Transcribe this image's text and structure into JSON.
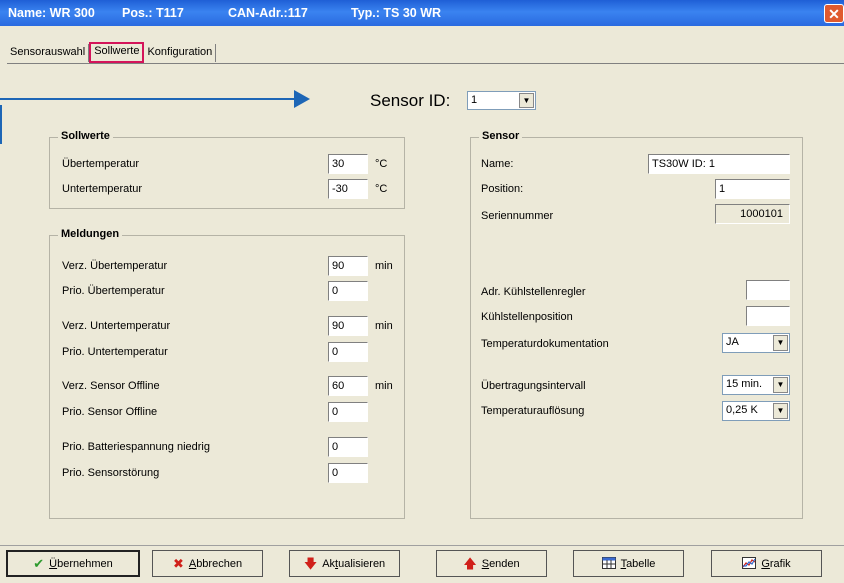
{
  "window": {
    "name_label": "Name: WR 300",
    "pos_label": "Pos.: T117",
    "can_label": "CAN-Adr.:117",
    "typ_label": "Typ.: TS 30 WR",
    "close_glyph": "✕"
  },
  "tabs": [
    {
      "label": "Sensorauswahl",
      "active": false
    },
    {
      "label": "Sollwerte",
      "active": true
    },
    {
      "label": "Konfiguration",
      "active": false
    }
  ],
  "sensor_id": {
    "label": "Sensor ID:",
    "value": "1"
  },
  "sollwerte": {
    "title": "Sollwerte",
    "rows": [
      {
        "label": "Übertemperatur",
        "value": "30",
        "unit": "°C"
      },
      {
        "label": "Untertemperatur",
        "value": "-30",
        "unit": "°C"
      }
    ]
  },
  "meldungen": {
    "title": "Meldungen",
    "rows": [
      {
        "label": "Verz. Übertemperatur",
        "value": "90",
        "unit": "min"
      },
      {
        "label": "Prio. Übertemperatur",
        "value": "0",
        "unit": ""
      },
      {
        "label": "Verz. Untertemperatur",
        "value": "90",
        "unit": "min"
      },
      {
        "label": "Prio. Untertemperatur",
        "value": "0",
        "unit": ""
      },
      {
        "label": "Verz. Sensor Offline",
        "value": "60",
        "unit": "min"
      },
      {
        "label": "Prio. Sensor Offline",
        "value": "0",
        "unit": ""
      },
      {
        "label": "Prio. Batteriespannung niedrig",
        "value": "0",
        "unit": ""
      },
      {
        "label": "Prio. Sensorstörung",
        "value": "0",
        "unit": ""
      }
    ]
  },
  "sensor": {
    "title": "Sensor",
    "name_label": "Name:",
    "name_value": "TS30W ID: 1",
    "position_label": "Position:",
    "position_value": "1",
    "serial_label": "Seriennummer",
    "serial_value": "1000101",
    "adr_label": "Adr. Kühlstellenregler",
    "adr_value": "",
    "kpos_label": "Kühlstellenposition",
    "kpos_value": "",
    "tempdoc_label": "Temperaturdokumentation",
    "tempdoc_value": "JA",
    "interval_label": "Übertragungsintervall",
    "interval_value": "15 min.",
    "resolution_label": "Temperaturauflösung",
    "resolution_value": "0,25 K"
  },
  "buttons": {
    "apply": {
      "first": "Ü",
      "rest": "bernehmen",
      "icon": "checkmark-icon",
      "color": "#2e9a2e"
    },
    "cancel": {
      "first": "A",
      "rest": "bbrechen",
      "icon": "x-icon",
      "color": "#d0201a"
    },
    "refresh": {
      "pre": "Ak",
      "ul": "t",
      "post": "ualisieren",
      "icon": "arrow-down-icon",
      "color": "#d0201a"
    },
    "send": {
      "first": "S",
      "rest": "enden",
      "icon": "arrow-up-icon",
      "color": "#d0201a"
    },
    "table": {
      "first": "T",
      "rest": "abelle",
      "icon": "table-icon"
    },
    "chart": {
      "first": "G",
      "rest": "rafik",
      "icon": "chart-icon"
    }
  },
  "colors": {
    "accent_tab_border": "#d4145a",
    "annotation_arrow": "#1d66b6",
    "titlebar": "#2a6ae0"
  }
}
